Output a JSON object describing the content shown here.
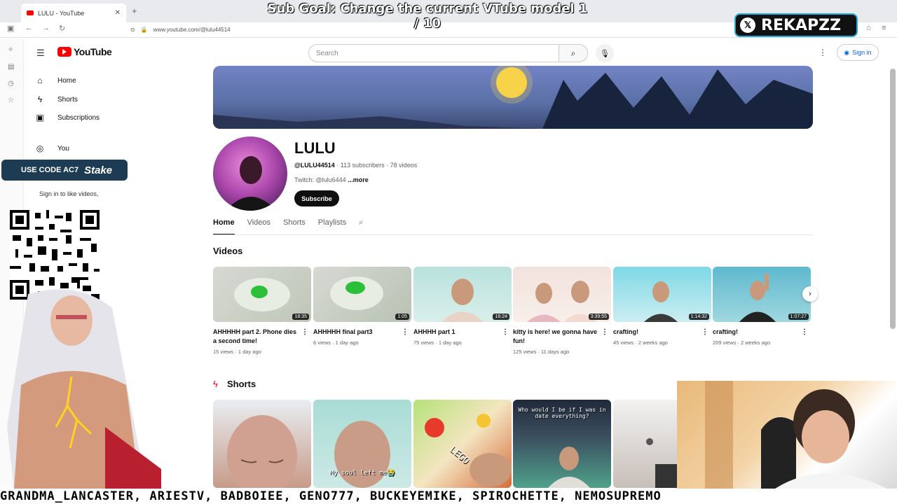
{
  "browser": {
    "tab_title": "LULU - YouTube",
    "url": "www.youtube.com/@lulu44514"
  },
  "overlay": {
    "sub_goal": "Sub Goal: Change the current VTube model 1 / 10",
    "handle": "REKAPZZ",
    "promo_text": "USE CODE AC7",
    "promo_brand": "Stake",
    "ticker": "GRANDMA_LANCASTER, ARIESTV, BADBOIEE, GENO777, BUCKEYEMIKE, SPIROCHETTE, NEMOSUPREMO"
  },
  "youtube": {
    "logo": "YouTube",
    "search_placeholder": "Search",
    "signin_label": "Sign in",
    "sidebar": [
      {
        "label": "Home",
        "icon": "home-icon"
      },
      {
        "label": "Shorts",
        "icon": "shorts-icon"
      },
      {
        "label": "Subscriptions",
        "icon": "subscriptions-icon"
      },
      {
        "label": "You",
        "icon": "you-icon"
      }
    ],
    "signin_note": "Sign in to like videos,",
    "channel": {
      "name": "LULU",
      "handle": "@LULU44514",
      "stats": "· 113 subscribers · 78 videos",
      "description": "Twitch: @lulu6444",
      "more": "...more",
      "subscribe_label": "Subscribe"
    },
    "tabs": [
      "Home",
      "Videos",
      "Shorts",
      "Playlists"
    ],
    "videos_heading": "Videos",
    "videos": [
      {
        "title": "AHHHHH part 2. Phone dies a second time!",
        "meta": "15 views · 1 day ago",
        "duration": "18:35"
      },
      {
        "title": "AHHHHH final part3",
        "meta": "6 views · 1 day ago",
        "duration": "1:05"
      },
      {
        "title": "AHHHH part 1",
        "meta": "75 views · 1 day ago",
        "duration": "16:24"
      },
      {
        "title": "kitty is here! we gonna have fun!",
        "meta": "125 views · 11 days ago",
        "duration": "3:39:55"
      },
      {
        "title": "crafting!",
        "meta": "45 views · 2 weeks ago",
        "duration": "1:14:32"
      },
      {
        "title": "crafting!",
        "meta": "209 views · 2 weeks ago",
        "duration": "1:07:27"
      }
    ],
    "shorts_heading": "Shorts",
    "shorts": [
      {
        "caption": ""
      },
      {
        "caption": "My soul left me😭"
      },
      {
        "caption": "LEGO"
      },
      {
        "caption": "Who would I be if I was in date everything?"
      },
      {
        "caption": ""
      }
    ]
  },
  "colors": {
    "brand_red": "#ff0000",
    "link_blue": "#065fd4",
    "handle_border": "#22aadd"
  }
}
